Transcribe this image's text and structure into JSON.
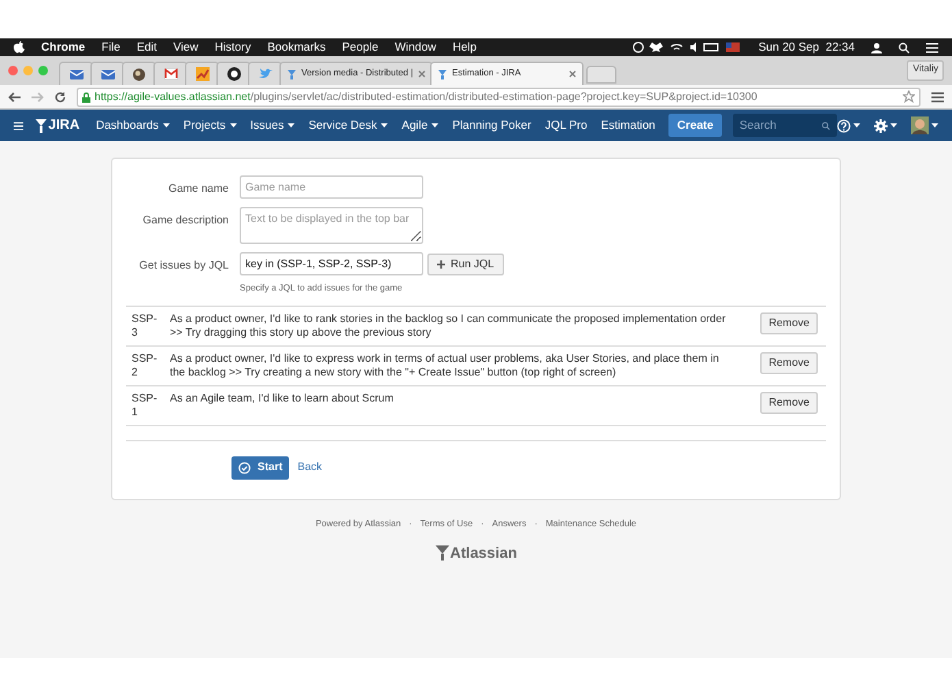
{
  "menubar": {
    "app": "Chrome",
    "items": [
      "File",
      "Edit",
      "View",
      "History",
      "Bookmarks",
      "People",
      "Window",
      "Help"
    ],
    "clock": "Sun 20 Sep  22:34"
  },
  "tabs": [
    {
      "kind": "icon",
      "selected": false
    },
    {
      "kind": "icon",
      "selected": false
    },
    {
      "kind": "icon",
      "selected": false
    },
    {
      "kind": "icon",
      "selected": false
    },
    {
      "kind": "icon",
      "selected": false
    },
    {
      "kind": "icon",
      "selected": false
    },
    {
      "kind": "icon",
      "selected": false
    },
    {
      "kind": "text",
      "title": "Version media - Distributed |",
      "selected": false
    },
    {
      "kind": "text",
      "title": "Estimation - JIRA",
      "selected": true
    }
  ],
  "profile": "Vitaliy",
  "address": {
    "host": "https://agile-values.atlassian.net",
    "path": "/plugins/servlet/ac/distributed-estimation/distributed-estimation-page?project.key=SUP&project.id=10300"
  },
  "nav": {
    "logo": "JIRA",
    "items": [
      {
        "label": "Dashboards",
        "dropdown": true
      },
      {
        "label": "Projects",
        "dropdown": true
      },
      {
        "label": "Issues",
        "dropdown": true
      },
      {
        "label": "Service Desk",
        "dropdown": true
      },
      {
        "label": "Agile",
        "dropdown": true
      },
      {
        "label": "Planning Poker",
        "dropdown": false
      },
      {
        "label": "JQL Pro",
        "dropdown": false
      },
      {
        "label": "Estimation",
        "dropdown": false
      }
    ],
    "create": "Create",
    "search_placeholder": "Search"
  },
  "form": {
    "fields": [
      {
        "kind": "input",
        "label": "Game name",
        "placeholder": "Game name"
      },
      {
        "kind": "textarea",
        "label": "Game description",
        "placeholder": "Text to be displayed in the top bar"
      },
      {
        "kind": "jql",
        "label": "Get issues by JQL",
        "value": "key in (SSP-1, SSP-2, SSP-3)",
        "button": "Run JQL",
        "hint": "Specify a JQL to add issues for the game"
      }
    ]
  },
  "issues": [
    {
      "key": "SSP-3",
      "summary": "As a product owner, I'd like to rank stories in the backlog so I can communicate the proposed implementation order >> Try dragging this story up above the previous story",
      "action": "Remove"
    },
    {
      "key": "SSP-2",
      "summary": "As a product owner, I'd like to express work in terms of actual user problems, aka User Stories, and place them in the backlog >> Try creating a new story with the \"+ Create Issue\" button (top right of screen)",
      "action": "Remove"
    },
    {
      "key": "SSP-1",
      "summary": "As an Agile team, I'd like to learn about Scrum",
      "action": "Remove"
    }
  ],
  "actions": {
    "start": "Start",
    "back": "Back"
  },
  "footer": {
    "links": [
      "Powered by Atlassian",
      "Terms of Use",
      "Answers",
      "Maintenance Schedule"
    ],
    "separator": "·",
    "logo": "Atlassian"
  }
}
